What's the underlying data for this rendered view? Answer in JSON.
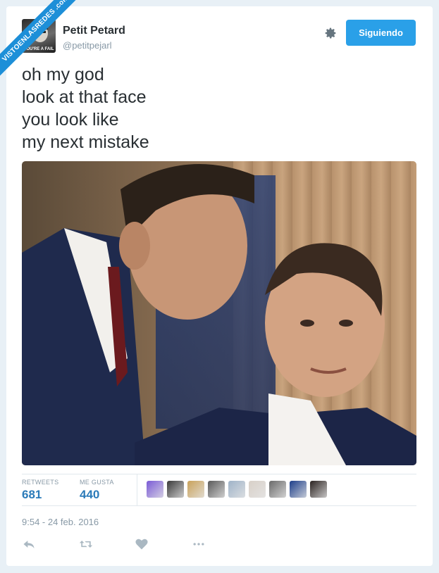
{
  "watermark": {
    "text": "VISTOENLASREDES .com"
  },
  "tweet": {
    "author_name": "Petit Petard",
    "author_handle": "@petitpejarl",
    "avatar_caption": "YOU'RE A FAIL",
    "follow_label": "Siguiendo",
    "text_lines": [
      "oh my god",
      "look at that face",
      "you look like",
      "my next mistake"
    ],
    "timestamp": "9:54 - 24 feb. 2016"
  },
  "stats": {
    "retweets_label": "RETWEETS",
    "retweets_value": "681",
    "likes_label": "ME GUSTA",
    "likes_value": "440"
  },
  "liker_colors": [
    "#7a5ad6",
    "#3a3a3a",
    "#c9a25a",
    "#5a5a5a",
    "#9fb3c8",
    "#d8d0c8",
    "#6a6a6a",
    "#1d3e8a",
    "#2a2220"
  ],
  "icons": {
    "gear": "gear-icon",
    "reply": "reply-icon",
    "retweet": "retweet-icon",
    "like": "heart-icon",
    "more": "more-icon"
  }
}
